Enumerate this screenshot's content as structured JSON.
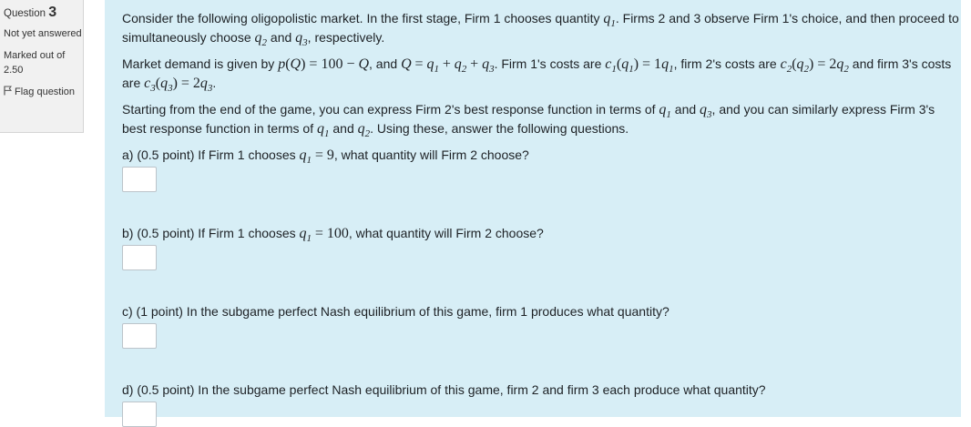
{
  "info": {
    "question_label": "Question",
    "question_number": "3",
    "state": "Not yet answered",
    "grade_label": "Marked out of",
    "grade_value": "2.50",
    "flag_label": "Flag question"
  },
  "text": {
    "intro_1": "Consider the following oligopolistic market. In the first stage, Firm 1 chooses quantity",
    "intro_2": ". Firms 2 and 3 observe Firm 1's choice, and then proceed to simultaneously choose",
    "intro_3": "and",
    "intro_4": ", respectively.",
    "market_1": "Market demand is given by",
    "market_2": ", and",
    "market_3": ". Firm 1's costs are",
    "market_4": ", firm 2's costs are",
    "market_5": "and firm 3's costs are",
    "market_6": ".",
    "br_1": "Starting from the end of the game, you can express Firm 2's best response function in terms of",
    "br_2": "and",
    "br_3": ", and you can similarly express Firm 3's best response function in terms of",
    "br_4": "and",
    "br_5": ". Using these, answer the following questions.",
    "qa_1": "a) (0.5 point) If Firm 1 chooses",
    "qa_val": "9",
    "qa_2": ", what quantity will Firm 2 choose?",
    "qb_1": "b) (0.5 point) If Firm 1 chooses",
    "qb_val": "100",
    "qb_2": ", what quantity will Firm 2 choose?",
    "qc": "c) (1 point) In the subgame perfect Nash equilibrium of this game, firm 1 produces what quantity?",
    "qd": "d) (0.5 point) In the subgame perfect Nash equilibrium of this game, firm 2 and firm 3 each produce what quantity?"
  },
  "answers": {
    "a": "",
    "b": "",
    "c": "",
    "d": ""
  }
}
